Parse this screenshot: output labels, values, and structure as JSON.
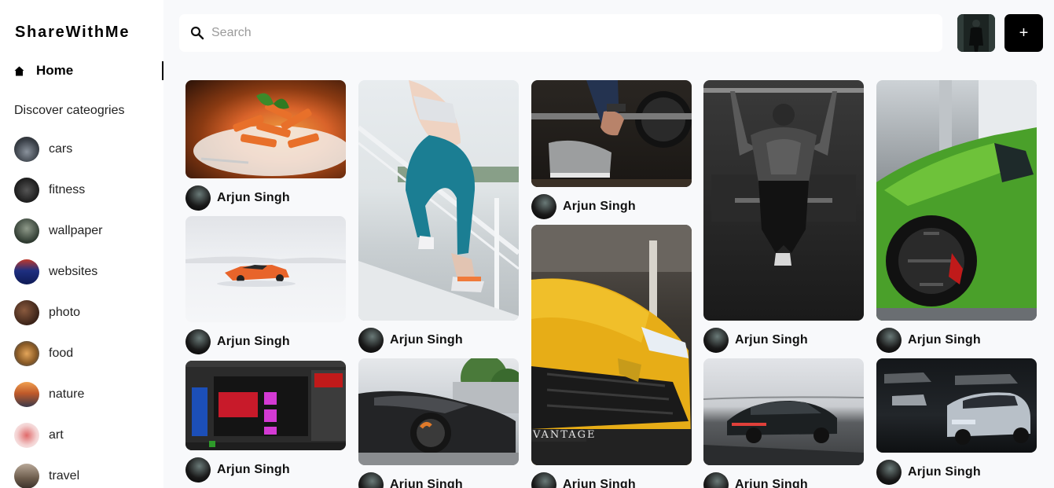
{
  "app": {
    "title": "ShareWithMe"
  },
  "nav": {
    "home_label": "Home",
    "home_icon": "home-icon"
  },
  "categories": {
    "title": "Discover cateogries",
    "items": [
      {
        "label": "cars",
        "color": "#5b6470"
      },
      {
        "label": "fitness",
        "color": "#2b2b2b"
      },
      {
        "label": "wallpaper",
        "color": "#3d4a3f"
      },
      {
        "label": "websites",
        "color": "#1f3a8a"
      },
      {
        "label": "photo",
        "color": "#4a2e22"
      },
      {
        "label": "food",
        "color": "#b07a3a"
      },
      {
        "label": "nature",
        "color": "#c96a2e"
      },
      {
        "label": "art",
        "color": "#d9a0a0"
      },
      {
        "label": "travel",
        "color": "#7a6a5a"
      }
    ]
  },
  "search": {
    "placeholder": "Search",
    "icon": "search-icon"
  },
  "header": {
    "add_label": "+"
  },
  "pins": [
    {
      "author": "Arjun Singh",
      "subject": "pasta"
    },
    {
      "author": "Arjun Singh",
      "subject": "car-in-snow"
    },
    {
      "author": "Arjun Singh",
      "subject": "editor-screenshot"
    },
    {
      "author": "Arjun Singh",
      "subject": "runner"
    },
    {
      "author": "Arjun Singh",
      "subject": "black-sports-car"
    },
    {
      "author": "Arjun Singh",
      "subject": "barbell"
    },
    {
      "author": "Arjun Singh",
      "subject": "yellow-suv"
    },
    {
      "author": "Arjun Singh",
      "subject": "pullups"
    },
    {
      "author": "Arjun Singh",
      "subject": "dark-sedan"
    },
    {
      "author": "Arjun Singh",
      "subject": "green-supercar"
    },
    {
      "author": "Arjun Singh",
      "subject": "white-car"
    }
  ]
}
